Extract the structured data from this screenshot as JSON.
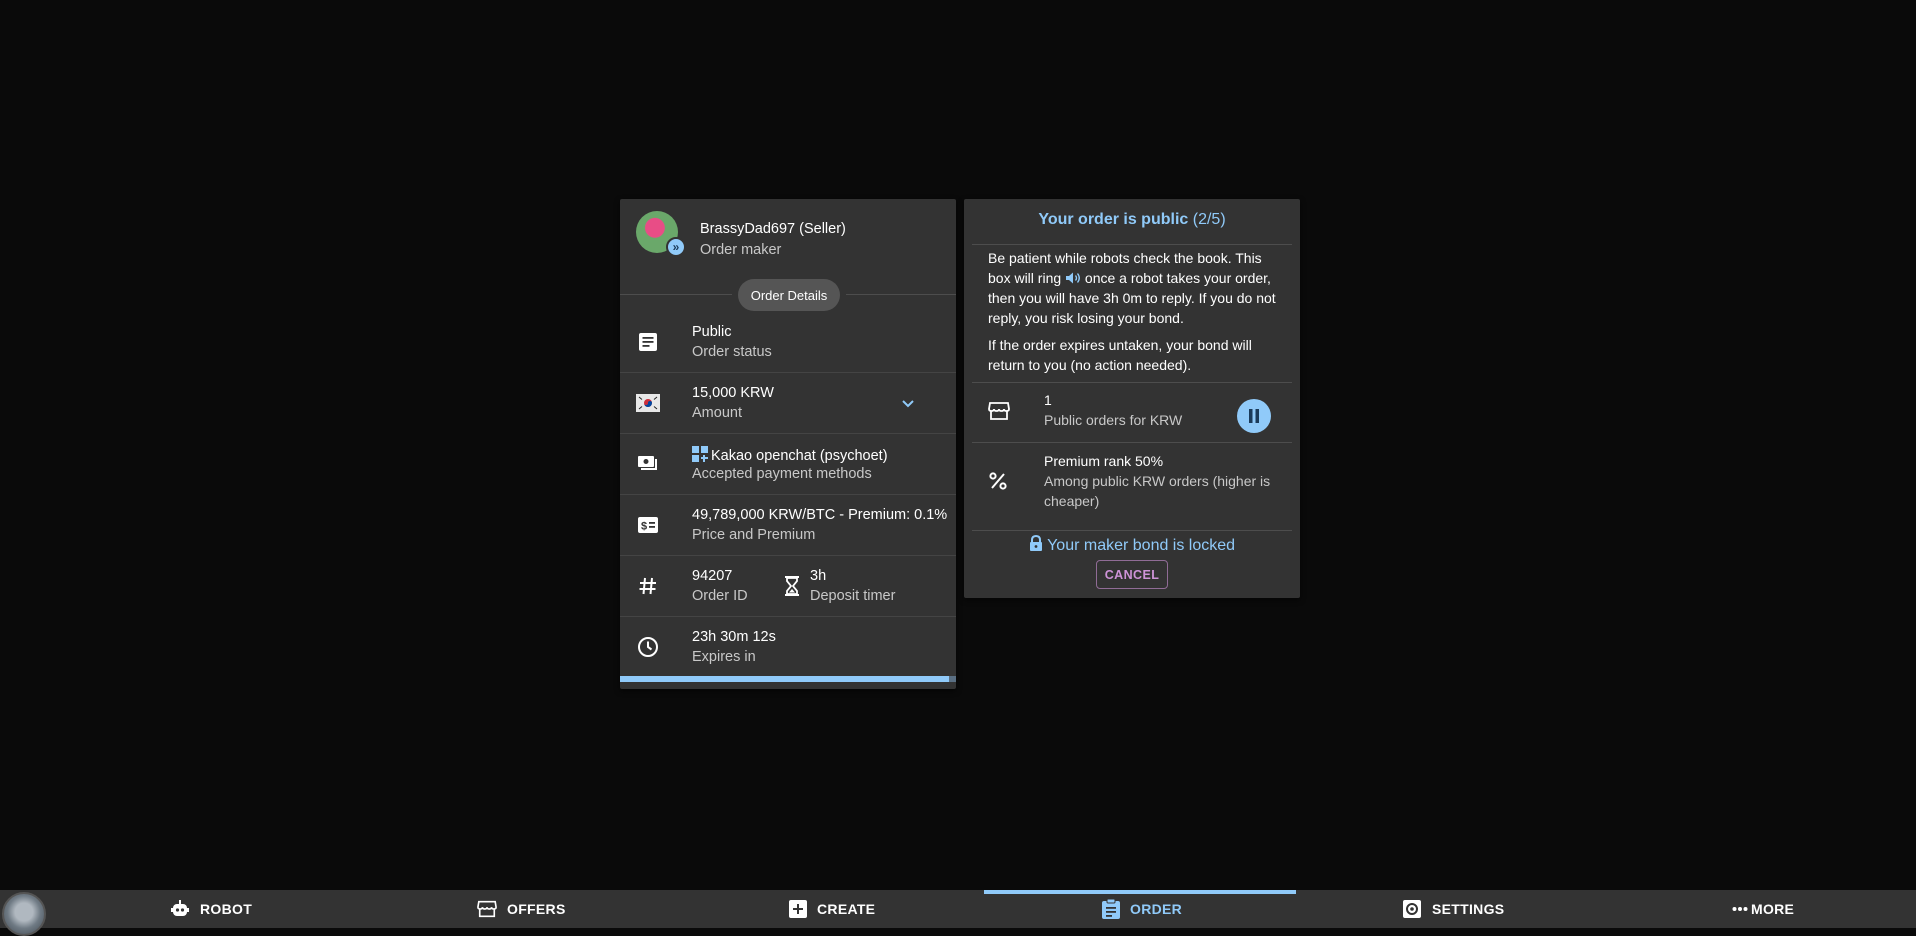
{
  "order_card": {
    "maker_name": "BrassyDad697 (Seller)",
    "maker_role": "Order maker",
    "details_chip": "Order Details",
    "status_value": "Public",
    "status_label": "Order status",
    "amount_value": "15,000 KRW",
    "amount_label": "Amount",
    "payment_value": "Kakao openchat (psychoet)",
    "payment_label": "Accepted payment methods",
    "price_value": "49,789,000 KRW/BTC - Premium: 0.1%",
    "price_label": "Price and Premium",
    "order_id_value": "94207",
    "order_id_label": "Order ID",
    "deposit_value": "3h",
    "deposit_label": "Deposit timer",
    "expires_value": "23h 30m 12s",
    "expires_label": "Expires in",
    "expiry_progress_percent": 98
  },
  "status_card": {
    "title": "Your order is public",
    "step": "(2/5)",
    "text_part1": "Be patient while robots check the book. This box will ring",
    "text_part2": "once a robot takes your order, then you will have 3h 0m to reply. If you do not reply, you risk losing your bond.",
    "text_expire": "If the order expires untaken, your bond will return to you (no action needed).",
    "public_orders_value": "1",
    "public_orders_label": "Public orders for KRW",
    "premium_rank_value": "Premium rank 50%",
    "premium_rank_label": "Among public KRW orders (higher is cheaper)",
    "bond_text": "Your maker bond is locked",
    "cancel_label": "CANCEL"
  },
  "nav": {
    "robot": "ROBOT",
    "offers": "OFFERS",
    "create": "CREATE",
    "order": "ORDER",
    "settings": "SETTINGS",
    "more": "MORE",
    "active": "order"
  },
  "colors": {
    "accent": "#90caf9",
    "cancel": "#ce93d8",
    "card_bg": "#333333",
    "page_bg": "#0a0a0a"
  }
}
